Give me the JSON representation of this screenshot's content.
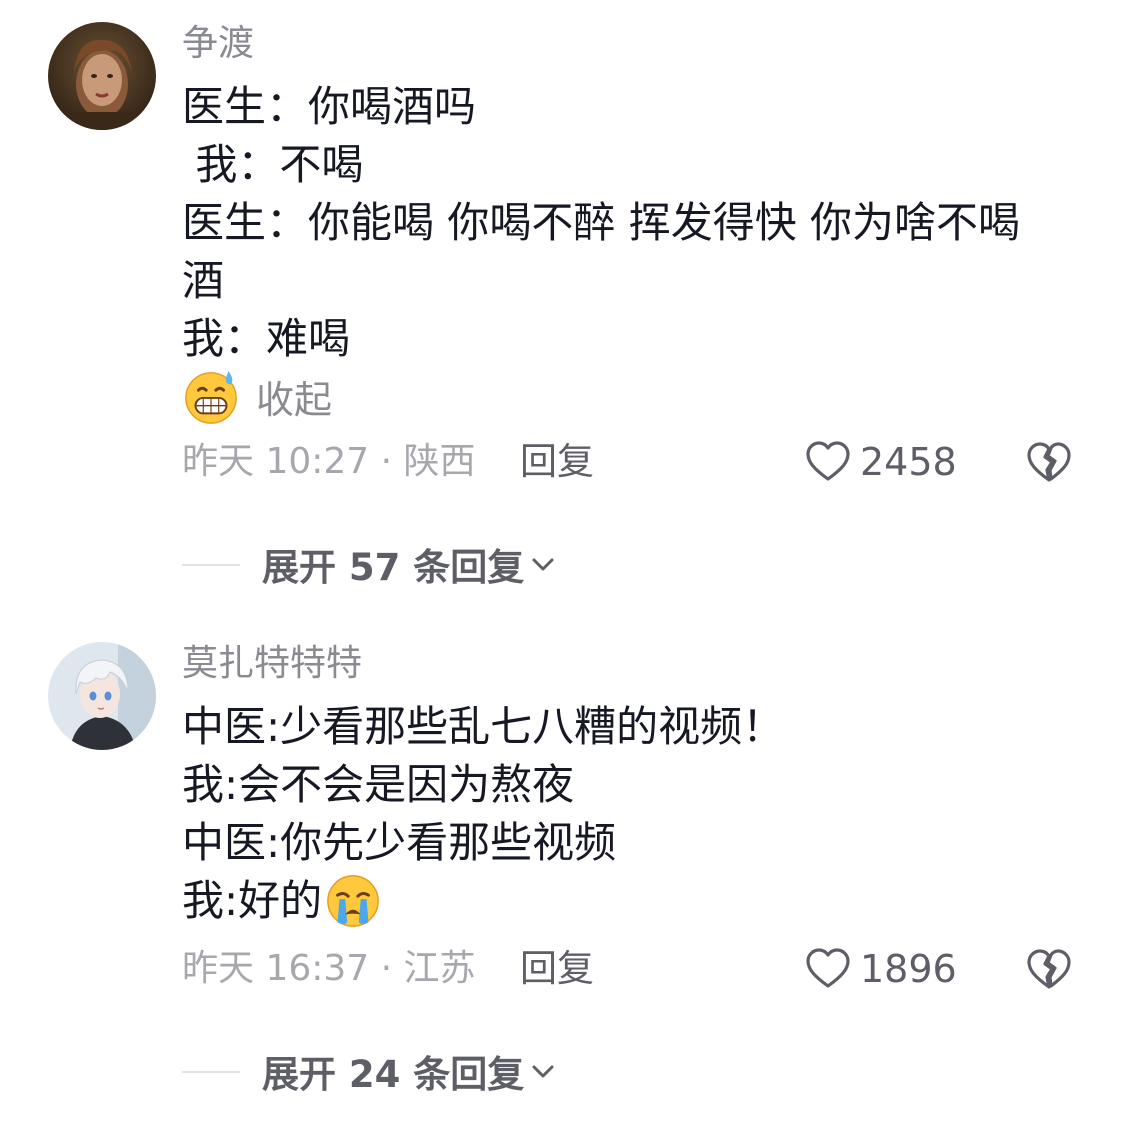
{
  "comments": [
    {
      "username": "争渡",
      "avatar_icon": "avatar-girl-portrait",
      "lines": [
        "医生：你喝酒吗",
        " 我：不喝",
        "医生：你能喝 你喝不醉 挥发得快 你为啥不喝",
        "酒",
        "我：难喝"
      ],
      "emoji_icon": "grinning-sweat-emoji",
      "collapse_label": "收起",
      "time_location": "昨天 10:27 · 陕西",
      "reply_label": "回复",
      "like_count": "2458",
      "expand_label": "展开 57 条回复"
    },
    {
      "username": "莫扎特特特",
      "avatar_icon": "avatar-anime-boy",
      "lines": [
        "中医:少看那些乱七八糟的视频！",
        "我:会不会是因为熬夜",
        "中医:你先少看那些视频",
        "我:好的"
      ],
      "emoji_icon": "crying-emoji",
      "time_location": "昨天 16:37 · 江苏",
      "reply_label": "回复",
      "like_count": "1896",
      "expand_label": "展开 24 条回复"
    }
  ],
  "colors": {
    "primary_text": "#161823",
    "username": "#8a8b91",
    "meta": "#a7a8ad",
    "action": "#5d5e66"
  }
}
